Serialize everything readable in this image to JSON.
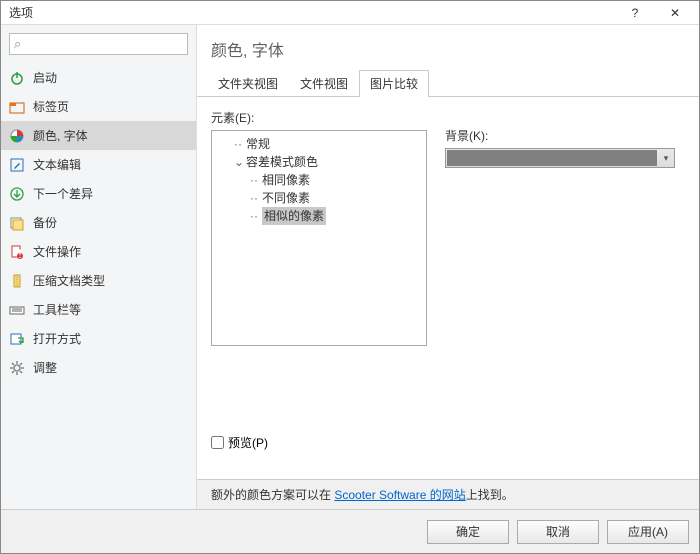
{
  "window": {
    "title": "选项",
    "help": "?",
    "close": "✕"
  },
  "search": {
    "placeholder": ""
  },
  "nav": {
    "items": [
      {
        "label": "启动"
      },
      {
        "label": "标签页"
      },
      {
        "label": "颜色, 字体"
      },
      {
        "label": "文本编辑"
      },
      {
        "label": "下一个差异"
      },
      {
        "label": "备份"
      },
      {
        "label": "文件操作"
      },
      {
        "label": "压缩文档类型"
      },
      {
        "label": "工具栏等"
      },
      {
        "label": "打开方式"
      },
      {
        "label": "调整"
      }
    ]
  },
  "content": {
    "heading": "颜色, 字体",
    "tabs": [
      {
        "label": "文件夹视图"
      },
      {
        "label": "文件视图"
      },
      {
        "label": "图片比较"
      }
    ],
    "element_label": "元素(E):",
    "background_label": "背景(K):",
    "tree": {
      "n0": "常规",
      "n1": "容差模式颜色",
      "n1_0": "相同像素",
      "n1_1": "不同像素",
      "n1_2": "相似的像素"
    },
    "preview_label": "预览(P)",
    "footer_before": "额外的颜色方案可以在 ",
    "footer_link": "Scooter Software 的网站",
    "footer_after": "上找到。"
  },
  "buttons": {
    "ok": "确定",
    "cancel": "取消",
    "apply": "应用(A)"
  }
}
